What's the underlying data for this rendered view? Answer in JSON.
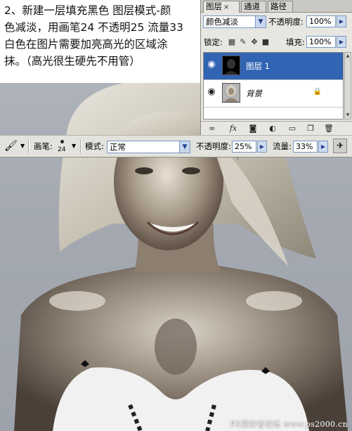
{
  "tutorial": {
    "lines": [
      "2、新建一层填充黑色 图层模式-颜",
      "色减淡，用画笔24 不透明25 流量33",
      "白色在图片需要加亮高光的区域涂",
      "抹。（高光很生硬先不用管）"
    ]
  },
  "layers_panel": {
    "tabs": [
      {
        "label": "图层",
        "close": "×",
        "active": true
      },
      {
        "label": "通道",
        "active": false
      },
      {
        "label": "路径",
        "active": false
      }
    ],
    "blend_mode": "颜色减淡",
    "opacity_label": "不透明度:",
    "opacity_value": "100%",
    "lock_label": "锁定:",
    "fill_label": "填充:",
    "fill_value": "100%",
    "layers": [
      {
        "name": "图层 1",
        "selected": true,
        "visible_icon": "eye-icon"
      },
      {
        "name": "背景",
        "selected": false,
        "visible_icon": "eye-icon",
        "locked": true
      }
    ],
    "bottom_icons": [
      "link-icon",
      "fx-icon",
      "mask-icon",
      "adjustment-icon",
      "group-folder-icon",
      "new-layer-icon",
      "trash-icon"
    ]
  },
  "options_bar": {
    "tool_icon": "brush-icon",
    "brush_label": "画笔:",
    "brush_size": "24",
    "mode_label": "模式:",
    "mode_value": "正常",
    "opacity_label": "不透明度:",
    "opacity_value": "25%",
    "flow_label": "流量:",
    "flow_value": "33%",
    "airbrush_icon": "airbrush-icon"
  },
  "watermark": "PS爱好者论坛 www.ps2000.cn"
}
